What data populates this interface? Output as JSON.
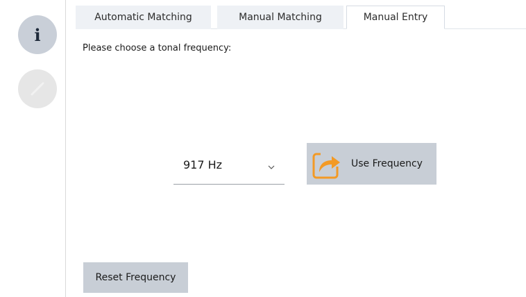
{
  "rail": {
    "info_glyph": "i",
    "info_icon": "info-icon",
    "disabled_icon": "edit-pencil-icon"
  },
  "tabs": [
    {
      "label": "Automatic Matching",
      "selected": false
    },
    {
      "label": "Manual Matching",
      "selected": false
    },
    {
      "label": "Manual Entry",
      "selected": true
    }
  ],
  "prompt": "Please choose a tonal frequency:",
  "frequency_select": {
    "value": "917 Hz",
    "icon": "chevron-down-icon"
  },
  "use_frequency_button": {
    "label": "Use Frequency",
    "icon": "share-arrow-icon",
    "accent": "#f39a25"
  },
  "reset_button": {
    "label": "Reset Frequency"
  },
  "colors": {
    "button_bg": "#c8ced6",
    "tab_bg": "#eef1f5",
    "info_circle": "#c9cfd8",
    "disabled_circle": "#e6e6e6"
  }
}
